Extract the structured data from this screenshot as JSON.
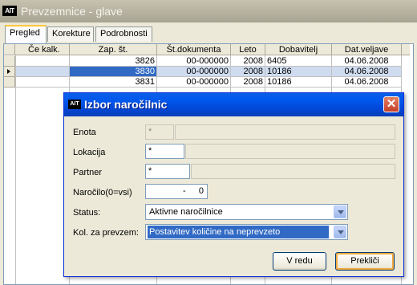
{
  "window": {
    "title": "Prevzemnice - glave",
    "logo": "AIT"
  },
  "tabs": [
    {
      "label": "Pregled"
    },
    {
      "label": "Korekture"
    },
    {
      "label": "Podrobnosti"
    }
  ],
  "grid": {
    "columns": [
      "Če kalk.",
      "Zap. št.",
      "Št.dokumenta",
      "Leto",
      "Dobavitelj",
      "Dat.veljave"
    ],
    "rows": [
      {
        "zap": "3826",
        "dok": "00-000000",
        "leto": "2008",
        "dob": "6405",
        "dat": "04.06.2008"
      },
      {
        "zap": "3830",
        "dok": "00-000000",
        "leto": "2008",
        "dob": "10186",
        "dat": "04.06.2008"
      },
      {
        "zap": "3831",
        "dok": "00-000000",
        "leto": "2008",
        "dob": "10186",
        "dat": "04.06.2008"
      }
    ]
  },
  "dialog": {
    "title": "Izbor naročilnic",
    "logo": "AIT",
    "close_icon": "close-icon",
    "fields": {
      "enota": {
        "label": "Enota",
        "value": "*"
      },
      "lokacija": {
        "label": "Lokacija",
        "value": "*"
      },
      "partner": {
        "label": "Partner",
        "value": "*"
      },
      "narocilo": {
        "label": "Naročilo(0=vsi)",
        "value": "-",
        "value2": "0"
      },
      "status": {
        "label": "Status:",
        "value": "Aktivne naročilnice"
      },
      "kolicina": {
        "label": "Kol. za prevzem:",
        "value": "Postavitev količine na neprevzeto"
      }
    },
    "ok_label": "V redu",
    "cancel_label": "Prekliči"
  },
  "colors": {
    "dialog_title": "#0058ee",
    "selection": "#316ac5",
    "tab_accent": "#ffc83c"
  }
}
